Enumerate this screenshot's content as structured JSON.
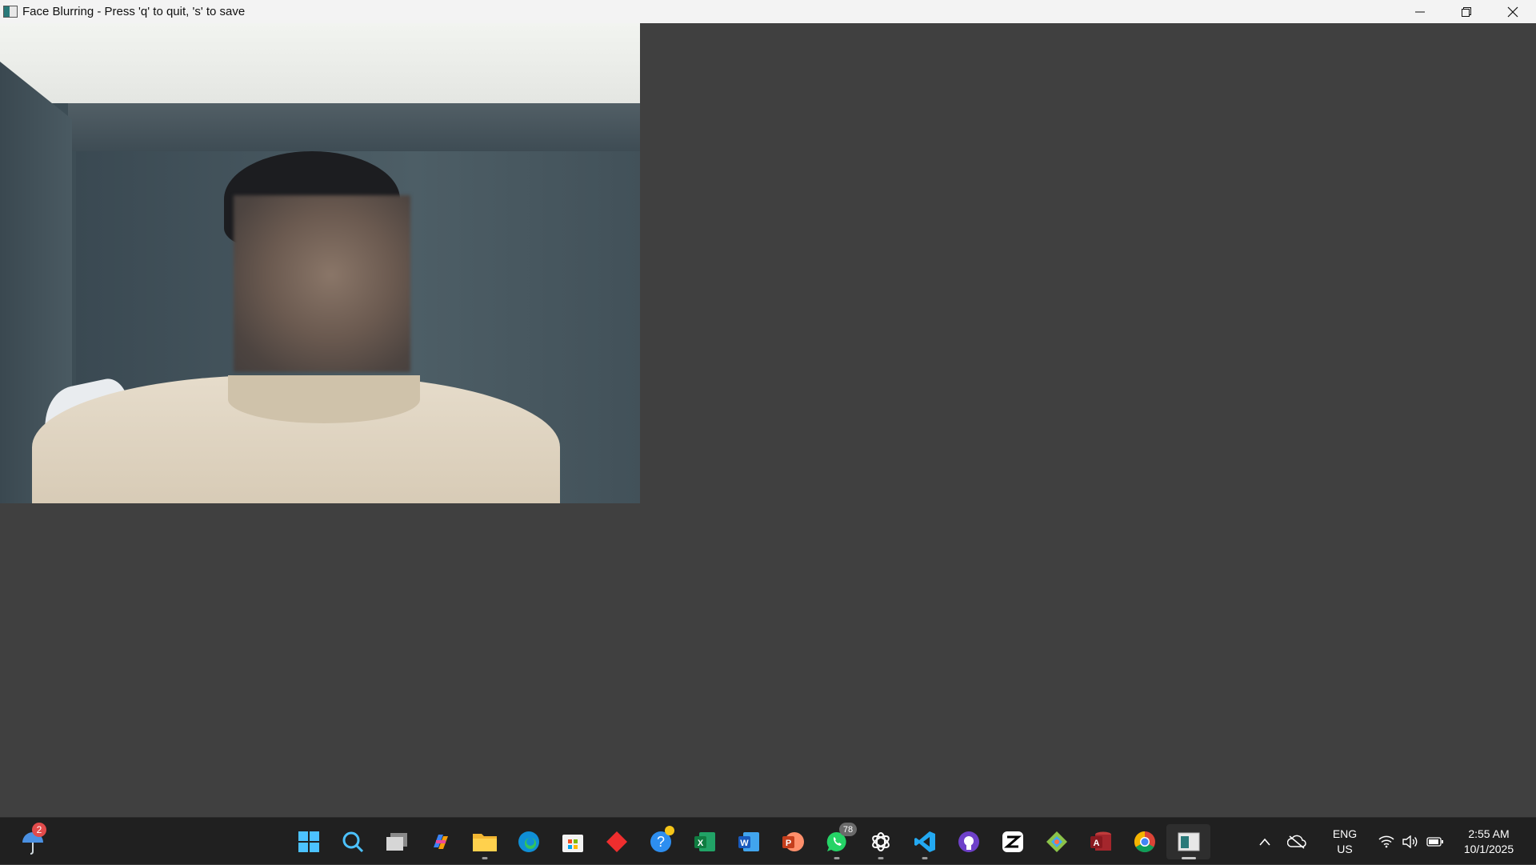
{
  "window": {
    "title": "Face Blurring - Press 'q' to quit, 's' to save",
    "controls": [
      "minimize",
      "restore",
      "close"
    ]
  },
  "weather": {
    "badge_count": "2"
  },
  "taskbar": {
    "pinned": [
      {
        "name": "start-icon"
      },
      {
        "name": "search-icon"
      },
      {
        "name": "task-view-icon"
      },
      {
        "name": "copilot-icon"
      },
      {
        "name": "file-explorer-icon"
      },
      {
        "name": "edge-icon"
      },
      {
        "name": "microsoft-store-icon"
      },
      {
        "name": "anydesk-icon"
      },
      {
        "name": "get-help-icon"
      },
      {
        "name": "excel-icon"
      },
      {
        "name": "word-icon"
      },
      {
        "name": "powerpoint-icon"
      },
      {
        "name": "whatsapp-icon"
      },
      {
        "name": "chatgpt-icon"
      },
      {
        "name": "vscode-icon"
      },
      {
        "name": "github-desktop-icon"
      },
      {
        "name": "capcut-icon"
      },
      {
        "name": "git-icon"
      },
      {
        "name": "access-icon"
      },
      {
        "name": "chrome-icon"
      },
      {
        "name": "face-blurring-app-icon"
      }
    ],
    "whatsapp_badge": "78"
  },
  "tray": {
    "language_line1": "ENG",
    "language_line2": "US",
    "time": "2:55 AM",
    "date": "10/1/2025"
  }
}
